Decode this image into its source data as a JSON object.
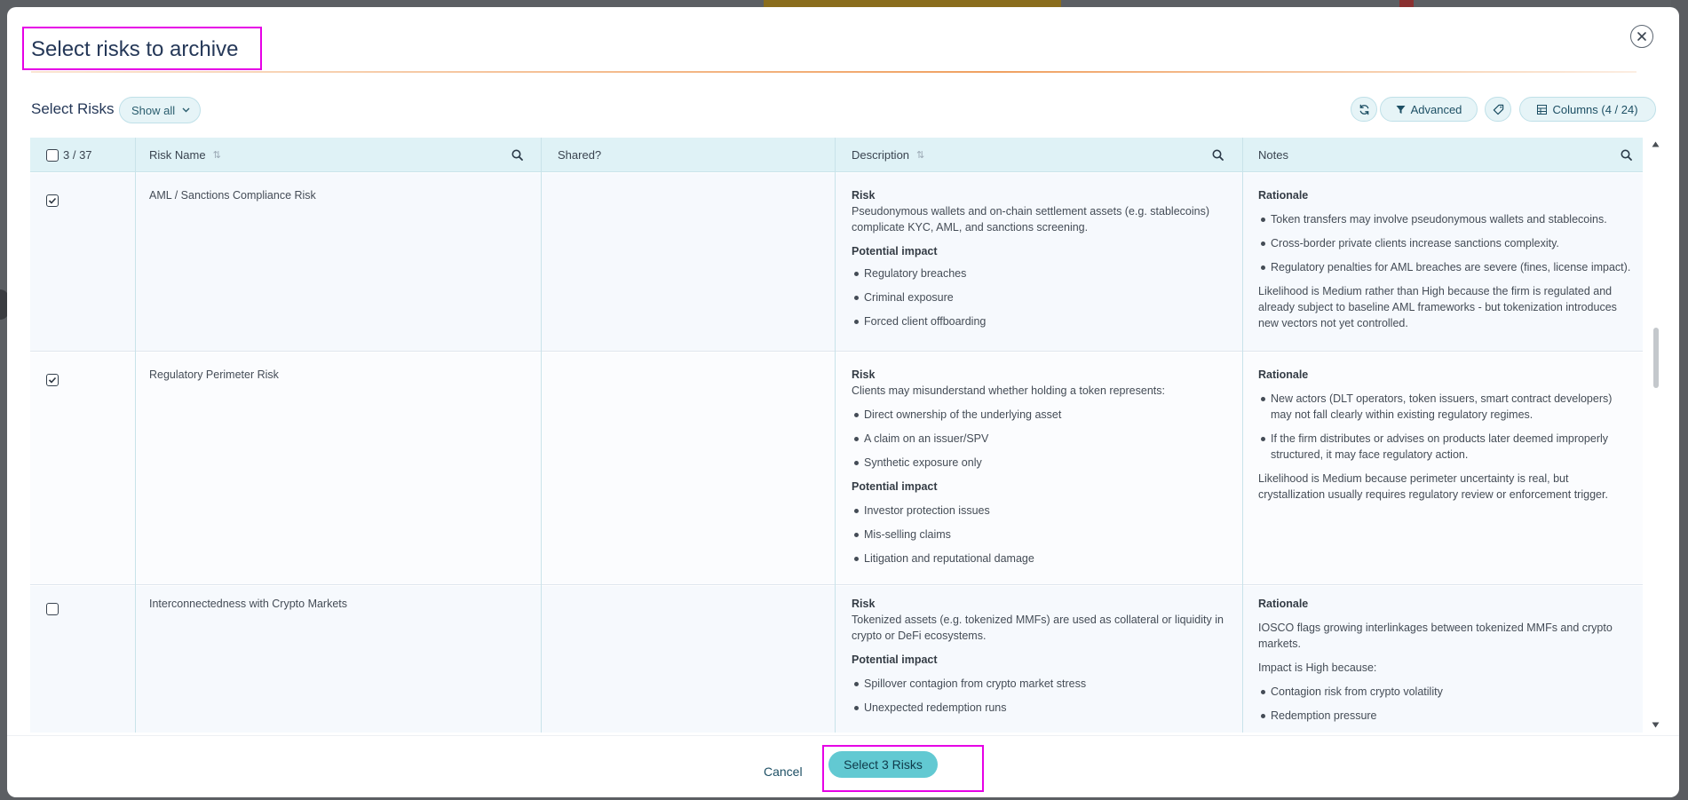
{
  "modal": {
    "title": "Select risks to archive",
    "select_label": "Select Risks",
    "filter": {
      "label": "Show all"
    },
    "toolbar": {
      "advanced_label": "Advanced",
      "columns_label": "Columns (4 / 24)"
    }
  },
  "table": {
    "selection_count": "3 / 37",
    "columns": [
      "Risk Name",
      "Shared?",
      "Description",
      "Notes"
    ],
    "rows": [
      {
        "checked": true,
        "name": "AML / Sanctions Compliance Risk",
        "shared": "",
        "description": {
          "risk_heading": "Risk",
          "risk_text": "Pseudonymous wallets and on-chain settlement assets (e.g. stablecoins) complicate KYC, AML, and sanctions screening.",
          "risk_bullets": [],
          "impact_heading": "Potential impact",
          "impact_bullets": [
            "Regulatory breaches",
            "Criminal exposure",
            "Forced client offboarding"
          ]
        },
        "notes": {
          "heading": "Rationale",
          "intro": "",
          "bullets": [
            "Token transfers may involve pseudonymous wallets and stablecoins.",
            "Cross-border private clients increase sanctions complexity.",
            "Regulatory penalties for AML breaches are severe (fines, license impact)."
          ],
          "closing": "Likelihood is Medium rather than High because the firm is regulated and already subject to baseline AML frameworks - but tokenization introduces new vectors not yet controlled."
        }
      },
      {
        "checked": true,
        "name": "Regulatory Perimeter Risk",
        "shared": "",
        "description": {
          "risk_heading": "Risk",
          "risk_text": "Clients may misunderstand whether holding a token represents:",
          "risk_bullets": [
            "Direct ownership of the underlying asset",
            "A claim on an issuer/SPV",
            "Synthetic exposure only"
          ],
          "impact_heading": "Potential impact",
          "impact_bullets": [
            "Investor protection issues",
            "Mis-selling claims",
            "Litigation and reputational damage"
          ]
        },
        "notes": {
          "heading": "Rationale",
          "intro": "",
          "bullets": [
            "New actors (DLT operators, token issuers, smart contract developers) may not fall clearly within existing regulatory regimes.",
            "If the firm distributes or advises on products later deemed improperly structured, it may face regulatory action."
          ],
          "closing": "Likelihood is Medium because perimeter uncertainty is real, but crystallization usually requires regulatory review or enforcement trigger."
        }
      },
      {
        "checked": false,
        "name": "Interconnectedness with Crypto Markets",
        "shared": "",
        "description": {
          "risk_heading": "Risk",
          "risk_text": "Tokenized assets (e.g. tokenized MMFs) are used as collateral or liquidity in crypto or DeFi ecosystems.",
          "risk_bullets": [],
          "impact_heading": "Potential impact",
          "impact_bullets": [
            "Spillover contagion from crypto market stress",
            "Unexpected redemption runs"
          ]
        },
        "notes": {
          "heading": "Rationale",
          "intro": "IOSCO flags growing interlinkages between tokenized MMFs and crypto markets.",
          "intro2": "Impact is High because:",
          "bullets": [
            "Contagion risk from crypto volatility",
            "Redemption pressure"
          ],
          "closing": ""
        }
      }
    ]
  },
  "footer": {
    "cancel_label": "Cancel",
    "primary_label": "Select 3 Risks"
  }
}
